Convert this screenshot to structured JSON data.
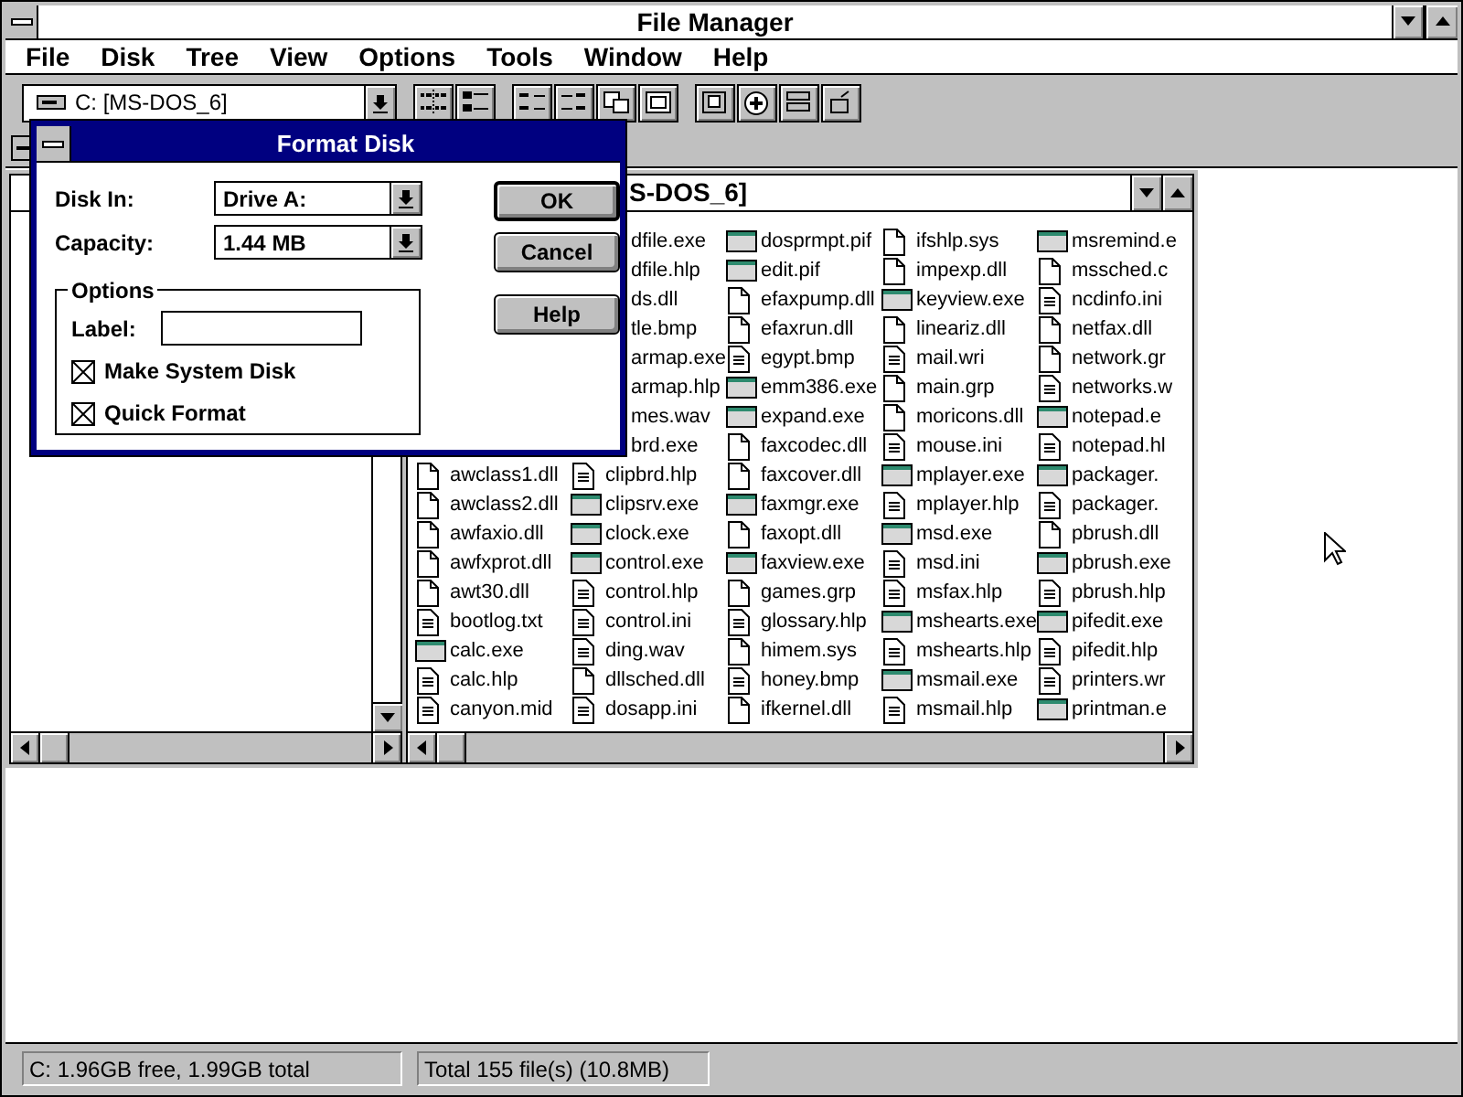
{
  "window": {
    "title": "File Manager"
  },
  "menu": [
    "File",
    "Disk",
    "Tree",
    "View",
    "Options",
    "Tools",
    "Window",
    "Help"
  ],
  "toolbar": {
    "drive": "C: [MS-DOS_6]",
    "groups": [
      {
        "buttons": [
          {
            "kind": "tree"
          },
          {
            "kind": "list"
          }
        ]
      },
      {
        "buttons": [
          {
            "kind": "sort_name"
          },
          {
            "kind": "sort_type"
          },
          {
            "kind": "copy"
          },
          {
            "kind": "move"
          }
        ]
      },
      {
        "buttons": [
          {
            "kind": "disk"
          },
          {
            "kind": "connect"
          },
          {
            "kind": "share"
          },
          {
            "kind": "stop"
          }
        ]
      }
    ]
  },
  "directory_window": {
    "title": "S-DOS_6]",
    "columns": [
      {
        "files": [
          {
            "name": "awclass1.dll",
            "kind": "file"
          },
          {
            "name": "awclass2.dll",
            "kind": "file"
          },
          {
            "name": "awfaxio.dll",
            "kind": "file"
          },
          {
            "name": "awfxprot.dll",
            "kind": "file"
          },
          {
            "name": "awt30.dll",
            "kind": "file"
          },
          {
            "name": "bootlog.txt",
            "kind": "document"
          },
          {
            "name": "calc.exe",
            "kind": "program"
          },
          {
            "name": "calc.hlp",
            "kind": "document"
          },
          {
            "name": "canyon.mid",
            "kind": "document"
          }
        ]
      },
      {
        "files": [
          {
            "name": "dfile.exe"
          },
          {
            "name": "dfile.hlp"
          },
          {
            "name": "ds.dll"
          },
          {
            "name": "tle.bmp"
          },
          {
            "name": "armap.exe"
          },
          {
            "name": "armap.hlp"
          },
          {
            "name": "mes.wav"
          },
          {
            "name": "brd.exe"
          },
          {
            "name": "clipbrd.hlp",
            "kind": "document"
          },
          {
            "name": "clipsrv.exe",
            "kind": "program"
          },
          {
            "name": "clock.exe",
            "kind": "program"
          },
          {
            "name": "control.exe",
            "kind": "program"
          },
          {
            "name": "control.hlp",
            "kind": "document"
          },
          {
            "name": "control.ini",
            "kind": "document"
          },
          {
            "name": "ding.wav",
            "kind": "document"
          },
          {
            "name": "dllsched.dll",
            "kind": "file"
          },
          {
            "name": "dosapp.ini",
            "kind": "document"
          }
        ]
      },
      {
        "files": [
          {
            "name": "dosprmpt.pif",
            "kind": "program"
          },
          {
            "name": "edit.pif",
            "kind": "program"
          },
          {
            "name": "efaxpump.dll",
            "kind": "file"
          },
          {
            "name": "efaxrun.dll",
            "kind": "file"
          },
          {
            "name": "egypt.bmp",
            "kind": "document"
          },
          {
            "name": "emm386.exe",
            "kind": "program"
          },
          {
            "name": "expand.exe",
            "kind": "program"
          },
          {
            "name": "faxcodec.dll",
            "kind": "file"
          },
          {
            "name": "faxcover.dll",
            "kind": "file"
          },
          {
            "name": "faxmgr.exe",
            "kind": "program"
          },
          {
            "name": "faxopt.dll",
            "kind": "file"
          },
          {
            "name": "faxview.exe",
            "kind": "program"
          },
          {
            "name": "games.grp",
            "kind": "file"
          },
          {
            "name": "glossary.hlp",
            "kind": "document"
          },
          {
            "name": "himem.sys",
            "kind": "file"
          },
          {
            "name": "honey.bmp",
            "kind": "document"
          },
          {
            "name": "ifkernel.dll",
            "kind": "file"
          }
        ]
      },
      {
        "files": [
          {
            "name": "ifshlp.sys",
            "kind": "file"
          },
          {
            "name": "impexp.dll",
            "kind": "file"
          },
          {
            "name": "keyview.exe",
            "kind": "program"
          },
          {
            "name": "lineariz.dll",
            "kind": "file"
          },
          {
            "name": "mail.wri",
            "kind": "document"
          },
          {
            "name": "main.grp",
            "kind": "file"
          },
          {
            "name": "moricons.dll",
            "kind": "file"
          },
          {
            "name": "mouse.ini",
            "kind": "document"
          },
          {
            "name": "mplayer.exe",
            "kind": "program"
          },
          {
            "name": "mplayer.hlp",
            "kind": "document"
          },
          {
            "name": "msd.exe",
            "kind": "program"
          },
          {
            "name": "msd.ini",
            "kind": "document"
          },
          {
            "name": "msfax.hlp",
            "kind": "document"
          },
          {
            "name": "mshearts.exe",
            "kind": "program"
          },
          {
            "name": "mshearts.hlp",
            "kind": "document"
          },
          {
            "name": "msmail.exe",
            "kind": "program"
          },
          {
            "name": "msmail.hlp",
            "kind": "document"
          }
        ]
      },
      {
        "files": [
          {
            "name": "msremind.e",
            "kind": "program"
          },
          {
            "name": "mssched.c",
            "kind": "file"
          },
          {
            "name": "ncdinfo.ini",
            "kind": "document"
          },
          {
            "name": "netfax.dll",
            "kind": "file"
          },
          {
            "name": "network.gr",
            "kind": "file"
          },
          {
            "name": "networks.w",
            "kind": "document"
          },
          {
            "name": "notepad.e",
            "kind": "program"
          },
          {
            "name": "notepad.hl",
            "kind": "document"
          },
          {
            "name": "packager.",
            "kind": "program"
          },
          {
            "name": "packager.",
            "kind": "document"
          },
          {
            "name": "pbrush.dll",
            "kind": "file"
          },
          {
            "name": "pbrush.exe",
            "kind": "program"
          },
          {
            "name": "pbrush.hlp",
            "kind": "document"
          },
          {
            "name": "pifedit.exe",
            "kind": "program"
          },
          {
            "name": "pifedit.hlp",
            "kind": "document"
          },
          {
            "name": "printers.wr",
            "kind": "document"
          },
          {
            "name": "printman.e",
            "kind": "program"
          }
        ]
      }
    ]
  },
  "dialog": {
    "title": "Format Disk",
    "fields": [
      {
        "label": "Disk In:",
        "value": "Drive A:"
      },
      {
        "label": "Capacity:",
        "value": "1.44 MB"
      }
    ],
    "options": {
      "legend": "Options",
      "label_field": {
        "label": "Label:"
      },
      "checkboxes": [
        {
          "label": "Make System Disk",
          "checked": true
        },
        {
          "label": "Quick Format",
          "checked": true
        }
      ]
    },
    "buttons": [
      {
        "label": "OK",
        "default": true
      },
      {
        "label": "Cancel",
        "default": false
      },
      {
        "label": "Help",
        "default": false
      }
    ]
  },
  "status_bar": [
    "C: 1.96GB free,  1.99GB total",
    "Total 155 file(s) (10.8MB)"
  ]
}
